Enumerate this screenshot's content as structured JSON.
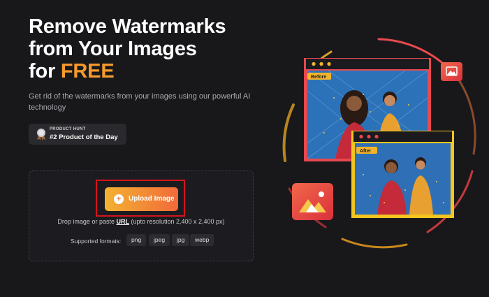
{
  "hero": {
    "line1": "Remove Watermarks",
    "line2": "from Your Images",
    "line3_prefix": "for ",
    "line3_highlight": "FREE",
    "subtitle": "Get rid of the watermarks from your images using our powerful AI technology"
  },
  "badge": {
    "small": "PRODUCT HUNT",
    "big": "#2 Product of the Day"
  },
  "upload": {
    "button_label": "Upload Image",
    "button_icon": "plus-icon",
    "drop_before": "Drop image or paste ",
    "drop_link": "URL",
    "drop_after": " (upto resolution 2,400 x 2,400 px)",
    "formats_label": "Supported formats:",
    "formats": [
      "png",
      "jpeg",
      "jpg",
      "webp"
    ]
  },
  "illustration": {
    "before_label": "Before",
    "after_label": "After",
    "icon": "image-icon"
  },
  "colors": {
    "background": "#18181b",
    "accent_orange": "#f59a2c",
    "before_frame": "#e8484e",
    "after_frame": "#f2c61f",
    "highlight_outline": "#d4141c"
  }
}
